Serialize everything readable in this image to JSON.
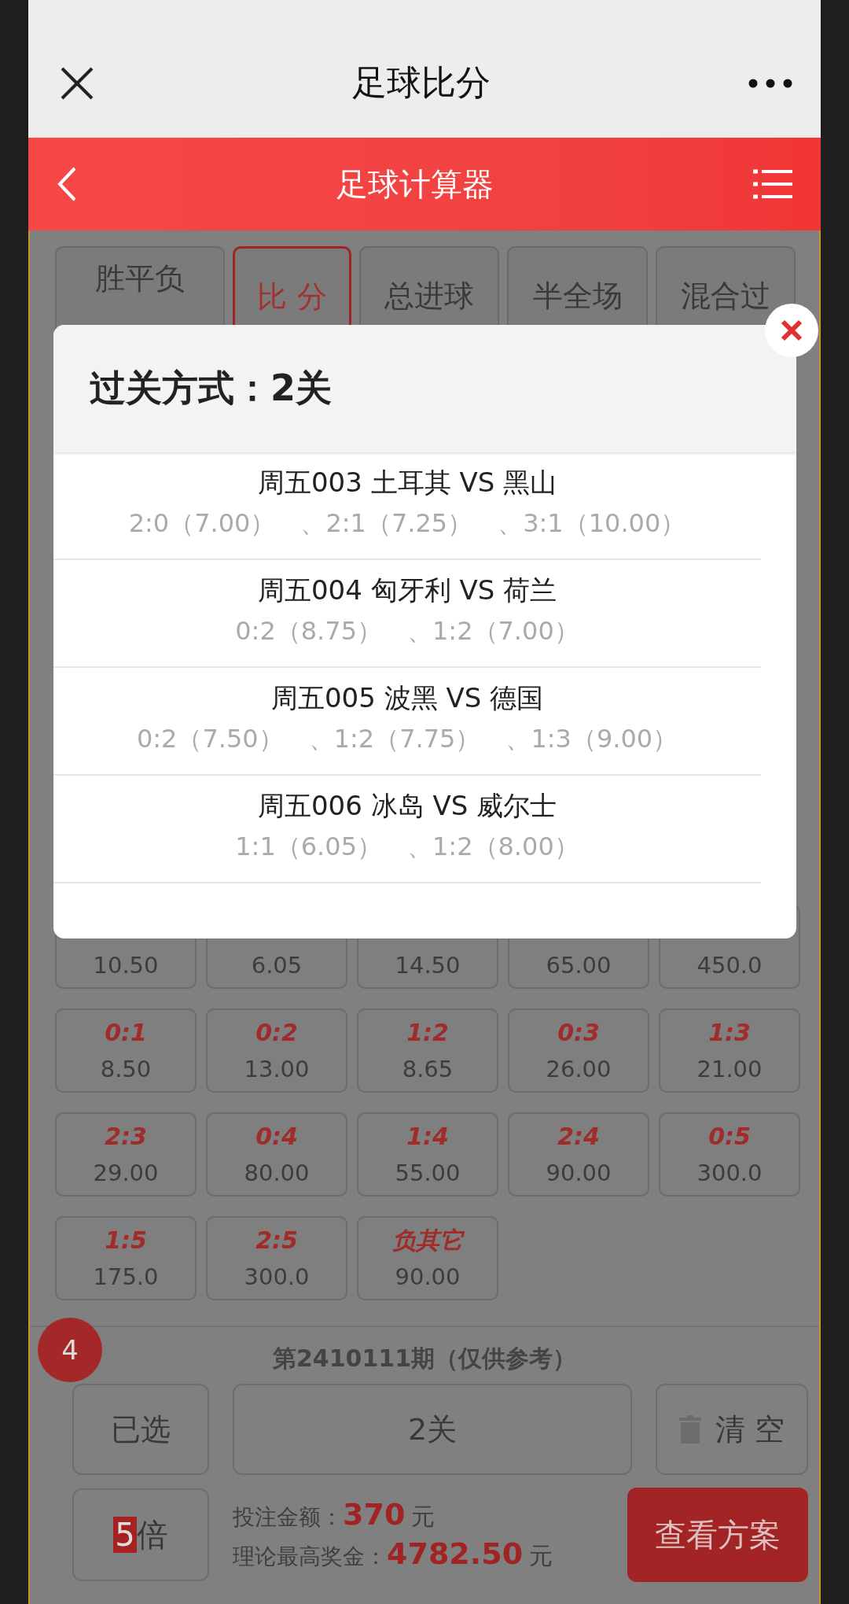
{
  "header": {
    "title": "足球比分"
  },
  "calculator_bar": {
    "title": "足球计算器"
  },
  "tabs": [
    {
      "label": "胜平负",
      "selected": false
    },
    {
      "label": "比 分",
      "selected": true
    },
    {
      "label": "总进球",
      "selected": false
    },
    {
      "label": "半全场",
      "selected": false
    },
    {
      "label": "混合过",
      "selected": false
    }
  ],
  "odds_grid": [
    {
      "value": "10.50"
    },
    {
      "value": "6.05"
    },
    {
      "value": "14.50"
    },
    {
      "value": "65.00"
    },
    {
      "value": "450.0"
    },
    {
      "score": "0:1",
      "value": "8.50"
    },
    {
      "score": "0:2",
      "value": "13.00"
    },
    {
      "score": "1:2",
      "value": "8.65"
    },
    {
      "score": "0:3",
      "value": "26.00"
    },
    {
      "score": "1:3",
      "value": "21.00"
    },
    {
      "score": "2:3",
      "value": "29.00"
    },
    {
      "score": "0:4",
      "value": "80.00"
    },
    {
      "score": "1:4",
      "value": "55.00"
    },
    {
      "score": "2:4",
      "value": "90.00"
    },
    {
      "score": "0:5",
      "value": "300.0"
    },
    {
      "score": "1:5",
      "value": "175.0"
    },
    {
      "score": "2:5",
      "value": "300.0"
    },
    {
      "score": "负其它",
      "value": "90.00"
    }
  ],
  "period": "第2410111期（仅供参考）",
  "selected_button": {
    "label": "已选",
    "count": "4"
  },
  "pass_button": {
    "label": "2关"
  },
  "clear_button": {
    "label": "清 空"
  },
  "multiplier": {
    "value": "5",
    "unit": "倍"
  },
  "stake": {
    "label": "投注金额：",
    "amount": "370",
    "unit": "元"
  },
  "max_prize": {
    "label": "理论最高奖金：",
    "amount": "4782.50",
    "unit": "元"
  },
  "view_plan_button": {
    "label": "查看方案"
  },
  "modal": {
    "title": "过关方式：2关",
    "matches": [
      {
        "title": "周五003 土耳其 VS 黑山",
        "picks": "2:0（7.00）　、2:1（7.25）　、3:1（10.00）"
      },
      {
        "title": "周五004 匈牙利 VS 荷兰",
        "picks": "0:2（8.75）　、1:2（7.00）"
      },
      {
        "title": "周五005 波黑 VS 德国",
        "picks": "0:2（7.50）　、1:2（7.75）　、1:3（9.00）"
      },
      {
        "title": "周五006 冰岛 VS 威尔士",
        "picks": "1:1（6.05）　、1:2（8.00）"
      }
    ]
  }
}
